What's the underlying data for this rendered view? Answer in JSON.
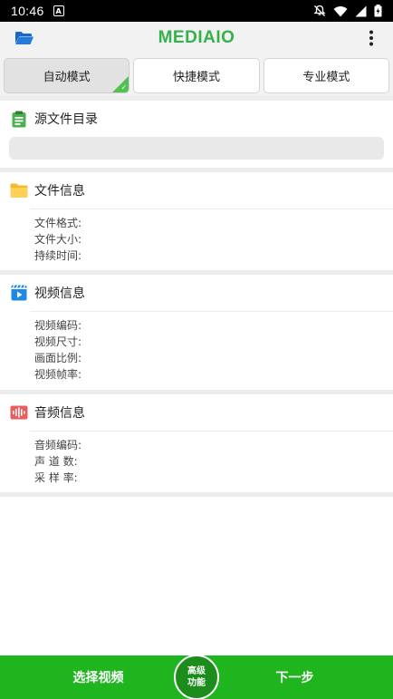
{
  "status_bar": {
    "time": "10:46",
    "notification_letter": "A"
  },
  "app_bar": {
    "title": "MEDIAIO",
    "brand_color": "#33b14a"
  },
  "tabs": [
    {
      "label": "自动模式",
      "active": true
    },
    {
      "label": "快捷模式",
      "active": false
    },
    {
      "label": "专业模式",
      "active": false
    }
  ],
  "source": {
    "title": "源文件目录",
    "path": ""
  },
  "file_info": {
    "title": "文件信息",
    "rows": [
      "文件格式:",
      "文件大小:",
      "持续时间:"
    ]
  },
  "video_info": {
    "title": "视频信息",
    "rows": [
      "视频编码:",
      "视频尺寸:",
      "画面比例:",
      "视频帧率:"
    ]
  },
  "audio_info": {
    "title": "音频信息",
    "rows": [
      "音频编码:",
      "声 道 数:",
      "采 样 率:"
    ]
  },
  "bottom": {
    "select_video": "选择视频",
    "advanced_line1": "高级",
    "advanced_line2": "功能",
    "next_step": "下一步",
    "bar_color": "#1fb51f"
  },
  "icons": {
    "folder": "folder-open-icon",
    "menu": "more-vert-icon",
    "source": "clipboard-icon",
    "file": "folder-icon",
    "video": "video-clapper-icon",
    "audio": "audio-wave-icon"
  }
}
